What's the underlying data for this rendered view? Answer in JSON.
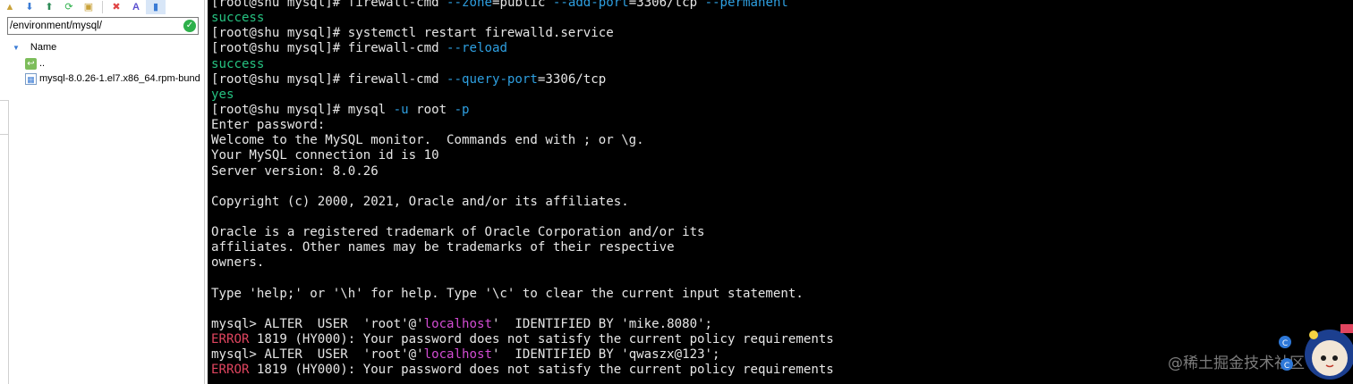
{
  "left_panel": {
    "toolbar_icons": [
      "folder-up-icon",
      "download-icon",
      "upload-icon",
      "refresh-icon",
      "new-file-icon",
      "delete-icon",
      "rename-icon",
      "properties-icon"
    ],
    "path": "/environment/mysql/",
    "column_header": "Name",
    "items": [
      {
        "name": "..",
        "icon": "parent-folder-icon"
      },
      {
        "name": "mysql-8.0.26-1.el7.x86_64.rpm-bund",
        "icon": "archive-file-icon"
      }
    ]
  },
  "terminal": {
    "lines": [
      {
        "segments": [
          {
            "t": "[root@shu mysql]# firewall-cmd "
          },
          {
            "t": "--zone",
            "c": "cyan"
          },
          {
            "t": "=public "
          },
          {
            "t": "--add-port",
            "c": "cyan"
          },
          {
            "t": "=3306/tcp "
          },
          {
            "t": "--permanent",
            "c": "cyan"
          }
        ]
      },
      {
        "segments": [
          {
            "t": "success",
            "c": "green"
          }
        ]
      },
      {
        "segments": [
          {
            "t": "[root@shu mysql]# systemctl restart firewalld.service"
          }
        ]
      },
      {
        "segments": [
          {
            "t": "[root@shu mysql]# firewall-cmd "
          },
          {
            "t": "--reload",
            "c": "cyan"
          }
        ]
      },
      {
        "segments": [
          {
            "t": "success",
            "c": "green"
          }
        ]
      },
      {
        "segments": [
          {
            "t": "[root@shu mysql]# firewall-cmd "
          },
          {
            "t": "--query-port",
            "c": "cyan"
          },
          {
            "t": "=3306/tcp"
          }
        ]
      },
      {
        "segments": [
          {
            "t": "yes",
            "c": "green"
          }
        ]
      },
      {
        "segments": [
          {
            "t": "[root@shu mysql]# mysql "
          },
          {
            "t": "-u",
            "c": "cyan"
          },
          {
            "t": " root "
          },
          {
            "t": "-p",
            "c": "cyan"
          }
        ]
      },
      {
        "segments": [
          {
            "t": "Enter password:"
          }
        ]
      },
      {
        "segments": [
          {
            "t": "Welcome to the MySQL monitor.  Commands end with ; or \\g."
          }
        ]
      },
      {
        "segments": [
          {
            "t": "Your MySQL connection id is 10"
          }
        ]
      },
      {
        "segments": [
          {
            "t": "Server version: 8.0.26"
          }
        ]
      },
      {
        "segments": [
          {
            "t": ""
          }
        ]
      },
      {
        "segments": [
          {
            "t": "Copyright (c) 2000, 2021, Oracle and/or its affiliates."
          }
        ]
      },
      {
        "segments": [
          {
            "t": ""
          }
        ]
      },
      {
        "segments": [
          {
            "t": "Oracle is a registered trademark of Oracle Corporation and/or its"
          }
        ]
      },
      {
        "segments": [
          {
            "t": "affiliates. Other names may be trademarks of their respective"
          }
        ]
      },
      {
        "segments": [
          {
            "t": "owners."
          }
        ]
      },
      {
        "segments": [
          {
            "t": ""
          }
        ]
      },
      {
        "segments": [
          {
            "t": "Type 'help;' or '\\h' for help. Type '\\c' to clear the current input statement."
          }
        ]
      },
      {
        "segments": [
          {
            "t": ""
          }
        ]
      },
      {
        "segments": [
          {
            "t": "mysql> ALTER  USER  'root'@'"
          },
          {
            "t": "localhost",
            "c": "magenta"
          },
          {
            "t": "'  IDENTIFIED BY 'mike.8080';"
          }
        ]
      },
      {
        "segments": [
          {
            "t": "ERROR",
            "c": "red"
          },
          {
            "t": " 1819 (HY000): Your password does not satisfy the current policy requirements"
          }
        ]
      },
      {
        "segments": [
          {
            "t": "mysql> ALTER  USER  'root'@'"
          },
          {
            "t": "localhost",
            "c": "magenta"
          },
          {
            "t": "'  IDENTIFIED BY 'qwaszx@123';"
          }
        ]
      },
      {
        "segments": [
          {
            "t": "ERROR",
            "c": "red"
          },
          {
            "t": " 1819 (HY000): Your password does not satisfy the current policy requirements"
          }
        ]
      }
    ]
  },
  "watermark": "@稀土掘金技术社区",
  "colors": {
    "green": "#26c281",
    "cyan": "#2e9fe0",
    "magenta": "#d34cd3",
    "red": "#e0455f",
    "text": "#e6e6e6",
    "terminal_bg": "#000000"
  }
}
